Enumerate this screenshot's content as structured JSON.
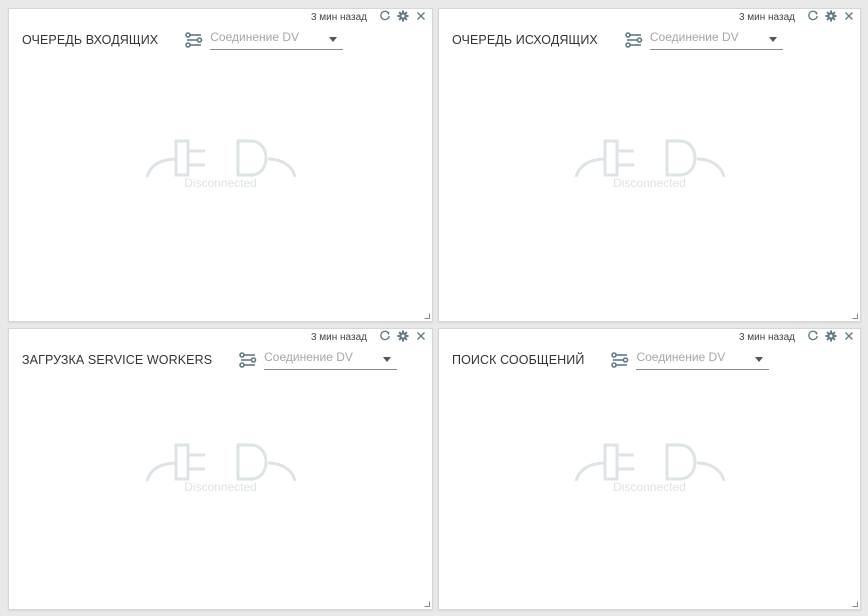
{
  "colors": {
    "icon": "#5e7a85",
    "plug": "#dde3e6",
    "caret": "#555555"
  },
  "widgets": [
    {
      "title": "ОЧЕРЕДЬ ВХОДЯЩИХ",
      "timestamp": "3 мин назад",
      "connection_placeholder": "Соединение DV",
      "status": "Disconnected"
    },
    {
      "title": "ОЧЕРЕДЬ ИСХОДЯЩИХ",
      "timestamp": "3 мин назад",
      "connection_placeholder": "Соединение DV",
      "status": "Disconnected"
    },
    {
      "title": "ЗАГРУЗКА SERVICE WORKERS",
      "timestamp": "3 мин назад",
      "connection_placeholder": "Соединение DV",
      "status": "Disconnected"
    },
    {
      "title": "ПОИСК СООБЩЕНИЙ",
      "timestamp": "3 мин назад",
      "connection_placeholder": "Соединение DV",
      "status": "Disconnected"
    }
  ],
  "icons": {
    "refresh": "refresh-icon",
    "settings": "gear-icon",
    "close": "close-icon",
    "connection": "connection-sliders-icon",
    "dropdown": "caret-down-icon",
    "disconnected": "unplugged-icon",
    "resize": "resize-handle-icon"
  }
}
